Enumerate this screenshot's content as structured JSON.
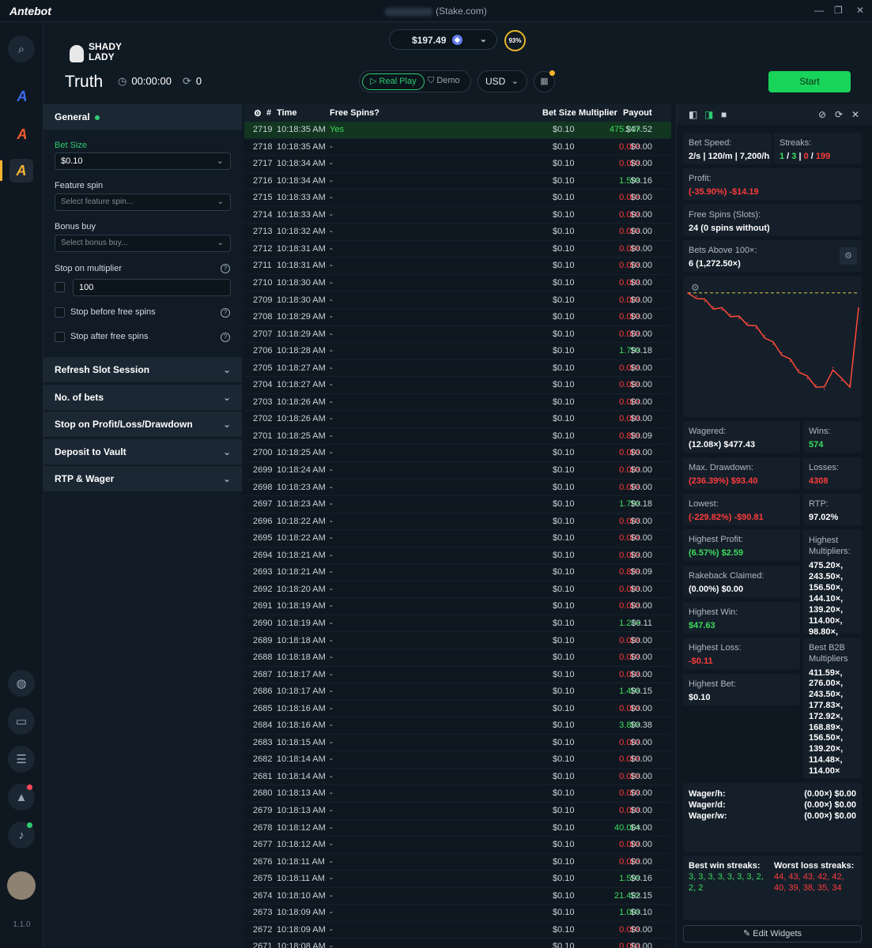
{
  "app": {
    "name": "Antebot",
    "window_title": "(Stake.com)",
    "version": "1.1.0"
  },
  "header": {
    "game_logo": "SHADY LADY",
    "game_name": "Truth",
    "timer": "00:00:00",
    "sessions": "0",
    "balance": "$197.49",
    "percent": "93%",
    "real_play": "Real Play",
    "demo": "Demo",
    "currency": "USD",
    "start": "Start"
  },
  "settings": {
    "general": "General",
    "bet_size_label": "Bet Size",
    "bet_size": "$0.10",
    "feature_spin_label": "Feature spin",
    "feature_spin_ph": "Select feature spin...",
    "bonus_buy_label": "Bonus buy",
    "bonus_buy_ph": "Select bonus buy...",
    "stop_mult_label": "Stop on multiplier",
    "stop_mult": "100",
    "stop_before": "Stop before free spins",
    "stop_after": "Stop after free spins",
    "sections": [
      "Refresh Slot Session",
      "No. of bets",
      "Stop on Profit/Loss/Drawdown",
      "Deposit to Vault",
      "RTP & Wager"
    ]
  },
  "table": {
    "headers": {
      "id": "#",
      "time": "Time",
      "fs": "Free Spins?",
      "bet": "Bet Size",
      "mult": "Multiplier",
      "pay": "Payout"
    },
    "rows": [
      [
        "2719",
        "10:18:35 AM",
        "Yes",
        "$0.10",
        "475.20×",
        "$47.52"
      ],
      [
        "2718",
        "10:18:35 AM",
        "-",
        "$0.10",
        "0.00×",
        "$0.00"
      ],
      [
        "2717",
        "10:18:34 AM",
        "-",
        "$0.10",
        "0.00×",
        "$0.00"
      ],
      [
        "2716",
        "10:18:34 AM",
        "-",
        "$0.10",
        "1.59×",
        "$0.16"
      ],
      [
        "2715",
        "10:18:33 AM",
        "-",
        "$0.10",
        "0.00×",
        "$0.00"
      ],
      [
        "2714",
        "10:18:33 AM",
        "-",
        "$0.10",
        "0.00×",
        "$0.00"
      ],
      [
        "2713",
        "10:18:32 AM",
        "-",
        "$0.10",
        "0.00×",
        "$0.00"
      ],
      [
        "2712",
        "10:18:31 AM",
        "-",
        "$0.10",
        "0.00×",
        "$0.00"
      ],
      [
        "2711",
        "10:18:31 AM",
        "-",
        "$0.10",
        "0.00×",
        "$0.00"
      ],
      [
        "2710",
        "10:18:30 AM",
        "-",
        "$0.10",
        "0.00×",
        "$0.00"
      ],
      [
        "2709",
        "10:18:30 AM",
        "-",
        "$0.10",
        "0.00×",
        "$0.00"
      ],
      [
        "2708",
        "10:18:29 AM",
        "-",
        "$0.10",
        "0.00×",
        "$0.00"
      ],
      [
        "2707",
        "10:18:29 AM",
        "-",
        "$0.10",
        "0.00×",
        "$0.00"
      ],
      [
        "2706",
        "10:18:28 AM",
        "-",
        "$0.10",
        "1.79×",
        "$0.18"
      ],
      [
        "2705",
        "10:18:27 AM",
        "-",
        "$0.10",
        "0.00×",
        "$0.00"
      ],
      [
        "2704",
        "10:18:27 AM",
        "-",
        "$0.10",
        "0.00×",
        "$0.00"
      ],
      [
        "2703",
        "10:18:26 AM",
        "-",
        "$0.10",
        "0.00×",
        "$0.00"
      ],
      [
        "2702",
        "10:18:26 AM",
        "-",
        "$0.10",
        "0.00×",
        "$0.00"
      ],
      [
        "2701",
        "10:18:25 AM",
        "-",
        "$0.10",
        "0.89×",
        "$0.09"
      ],
      [
        "2700",
        "10:18:25 AM",
        "-",
        "$0.10",
        "0.00×",
        "$0.00"
      ],
      [
        "2699",
        "10:18:24 AM",
        "-",
        "$0.10",
        "0.00×",
        "$0.00"
      ],
      [
        "2698",
        "10:18:23 AM",
        "-",
        "$0.10",
        "0.00×",
        "$0.00"
      ],
      [
        "2697",
        "10:18:23 AM",
        "-",
        "$0.10",
        "1.79×",
        "$0.18"
      ],
      [
        "2696",
        "10:18:22 AM",
        "-",
        "$0.10",
        "0.00×",
        "$0.00"
      ],
      [
        "2695",
        "10:18:22 AM",
        "-",
        "$0.10",
        "0.00×",
        "$0.00"
      ],
      [
        "2694",
        "10:18:21 AM",
        "-",
        "$0.10",
        "0.00×",
        "$0.00"
      ],
      [
        "2693",
        "10:18:21 AM",
        "-",
        "$0.10",
        "0.89×",
        "$0.09"
      ],
      [
        "2692",
        "10:18:20 AM",
        "-",
        "$0.10",
        "0.00×",
        "$0.00"
      ],
      [
        "2691",
        "10:18:19 AM",
        "-",
        "$0.10",
        "0.00×",
        "$0.00"
      ],
      [
        "2690",
        "10:18:19 AM",
        "-",
        "$0.10",
        "1.20×",
        "$0.11"
      ],
      [
        "2689",
        "10:18:18 AM",
        "-",
        "$0.10",
        "0.00×",
        "$0.00"
      ],
      [
        "2688",
        "10:18:18 AM",
        "-",
        "$0.10",
        "0.00×",
        "$0.00"
      ],
      [
        "2687",
        "10:18:17 AM",
        "-",
        "$0.10",
        "0.00×",
        "$0.00"
      ],
      [
        "2686",
        "10:18:17 AM",
        "-",
        "$0.10",
        "1.49×",
        "$0.15"
      ],
      [
        "2685",
        "10:18:16 AM",
        "-",
        "$0.10",
        "0.00×",
        "$0.00"
      ],
      [
        "2684",
        "10:18:16 AM",
        "-",
        "$0.10",
        "3.80×",
        "$0.38"
      ],
      [
        "2683",
        "10:18:15 AM",
        "-",
        "$0.10",
        "0.00×",
        "$0.00"
      ],
      [
        "2682",
        "10:18:14 AM",
        "-",
        "$0.10",
        "0.00×",
        "$0.00"
      ],
      [
        "2681",
        "10:18:14 AM",
        "-",
        "$0.10",
        "0.00×",
        "$0.00"
      ],
      [
        "2680",
        "10:18:13 AM",
        "-",
        "$0.10",
        "0.00×",
        "$0.00"
      ],
      [
        "2679",
        "10:18:13 AM",
        "-",
        "$0.10",
        "0.00×",
        "$0.00"
      ],
      [
        "2678",
        "10:18:12 AM",
        "-",
        "$0.10",
        "40.00×",
        "$4.00"
      ],
      [
        "2677",
        "10:18:12 AM",
        "-",
        "$0.10",
        "0.00×",
        "$0.00"
      ],
      [
        "2676",
        "10:18:11 AM",
        "-",
        "$0.10",
        "0.00×",
        "$0.00"
      ],
      [
        "2675",
        "10:18:11 AM",
        "-",
        "$0.10",
        "1.59×",
        "$0.16"
      ],
      [
        "2674",
        "10:18:10 AM",
        "-",
        "$0.10",
        "21.49×",
        "$2.15"
      ],
      [
        "2673",
        "10:18:09 AM",
        "-",
        "$0.10",
        "1.00×",
        "$0.10"
      ],
      [
        "2672",
        "10:18:09 AM",
        "-",
        "$0.10",
        "0.00×",
        "$0.00"
      ],
      [
        "2671",
        "10:18:08 AM",
        "-",
        "$0.10",
        "0.00×",
        "$0.00"
      ]
    ]
  },
  "widgets": {
    "bet_speed_label": "Bet Speed:",
    "bet_speed": "2/s | 120/m | 7,200/h",
    "streaks_label": "Streaks:",
    "streaks_a": "1",
    "streaks_b": "3",
    "streaks_c": "0",
    "streaks_d": "199",
    "profit_label": "Profit:",
    "profit": "(-35.90%) -$14.19",
    "free_spins_label": "Free Spins (Slots):",
    "free_spins": "24 (0 spins without)",
    "bets_above_label": "Bets Above 100×:",
    "bets_above": "6 (1,272.50×)",
    "wagered_label": "Wagered:",
    "wagered": "(12.08×) $477.43",
    "wins_label": "Wins:",
    "wins": "574",
    "max_dd_label": "Max. Drawdown:",
    "max_dd": "(236.39%) $93.40",
    "losses_label": "Losses:",
    "losses": "4308",
    "lowest_label": "Lowest:",
    "lowest": "(-229.82%) -$90.81",
    "rtp_label": "RTP:",
    "rtp": "97.02%",
    "hp_label": "Highest Profit:",
    "hp": "(6.57%) $2.59",
    "hm_label": "Highest Multipliers:",
    "hm": [
      "475.20×,",
      "243.50×,",
      "156.50×,",
      "144.10×,",
      "139.20×,",
      "114.00×,",
      "98.80×,"
    ],
    "rake_label": "Rakeback Claimed:",
    "rake": "(0.00%) $0.00",
    "hw_label": "Highest Win:",
    "hw": "$47.63",
    "hl_label": "Highest Loss:",
    "hl": "-$0.11",
    "b2b_label": "Best B2B Multipliers",
    "b2b": [
      "411.59×,",
      "276.00×,",
      "243.50×,",
      "177.83×,",
      "172.92×,",
      "168.89×,",
      "156.50×,",
      "139.20×,",
      "114.48×,",
      "114.00×"
    ],
    "hb_label": "Highest Bet:",
    "hb": "$0.10",
    "wager_h_label": "Wager/h:",
    "wager_h": "(0.00×) $0.00",
    "wager_d_label": "Wager/d:",
    "wager_d": "(0.00×) $0.00",
    "wager_w_label": "Wager/w:",
    "wager_w": "(0.00×) $0.00",
    "bws_label": "Best win streaks:",
    "bws": "3, 3, 3, 3, 3, 3, 3, 2, 2, 2",
    "wls_label": "Worst loss streaks:",
    "wls": "44, 43, 43, 42, 42, 40, 39, 38, 35, 34",
    "edit": "Edit Widgets"
  },
  "chart_data": {
    "type": "line",
    "title": "",
    "xlabel": "",
    "ylabel": "",
    "x": [
      0,
      5,
      10,
      15,
      20,
      25,
      30,
      35,
      40,
      45,
      50,
      55,
      60,
      65,
      70,
      75,
      80,
      85,
      90,
      95,
      100
    ],
    "y": [
      0,
      -3,
      -8,
      -13,
      -16,
      -20,
      -24,
      -28,
      -33,
      -40,
      -48,
      -56,
      -64,
      -72,
      -80,
      -86,
      -90,
      -70,
      -82,
      -86,
      -14
    ],
    "ylim": [
      -100,
      5
    ],
    "reference_line": 0,
    "colors": {
      "line": "#ff4a3a",
      "reference": "#e0c64a"
    }
  },
  "colors": {
    "accent": "#19d45a",
    "red": "#ff3b3b",
    "green": "#3ddc5b",
    "gold": "#e7b62a"
  }
}
